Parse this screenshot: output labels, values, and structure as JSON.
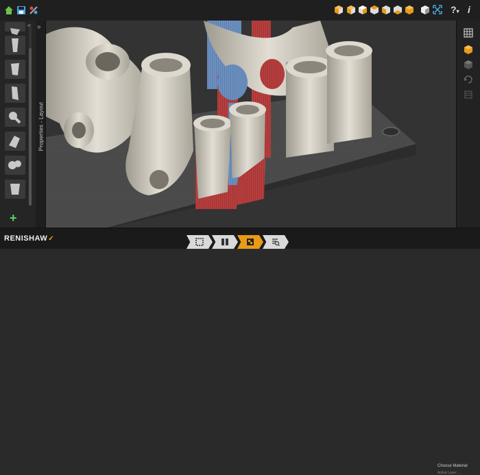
{
  "toolbar": {
    "left_icons": [
      "home-icon",
      "save-icon",
      "tools-icon"
    ],
    "view_icons": [
      "view-front-icon",
      "view-back-icon",
      "view-left-icon",
      "view-right-icon",
      "view-top-icon",
      "view-bottom-icon",
      "view-iso-icon"
    ],
    "right_icons": [
      "cube-iso-icon",
      "fit-view-icon"
    ],
    "help_label": "?",
    "help_caret": "▾",
    "info_label": "i"
  },
  "sidebar": {
    "collapse_label": "«",
    "expand_label": "»",
    "properties_label": "Properties - Layout",
    "add_label": "+"
  },
  "status": {
    "text": "Choose Material",
    "sub": "Active Layer: ...."
  },
  "brand": {
    "name": "RENISHAW",
    "mark": "✓"
  },
  "colors": {
    "accent": "#e99a16",
    "toolbar_bg": "#1f1f1f",
    "part": "#d0ccc0",
    "support_red": "#b33a3a",
    "support_blue": "#5a7fb0",
    "plate": "#4a4a4a",
    "add": "#5fd35f"
  },
  "workflow_steps": [
    {
      "icon": "build-area-icon",
      "active": false
    },
    {
      "icon": "parts-icon",
      "active": false
    },
    {
      "icon": "layout-icon",
      "active": true
    },
    {
      "icon": "review-icon",
      "active": false
    }
  ]
}
